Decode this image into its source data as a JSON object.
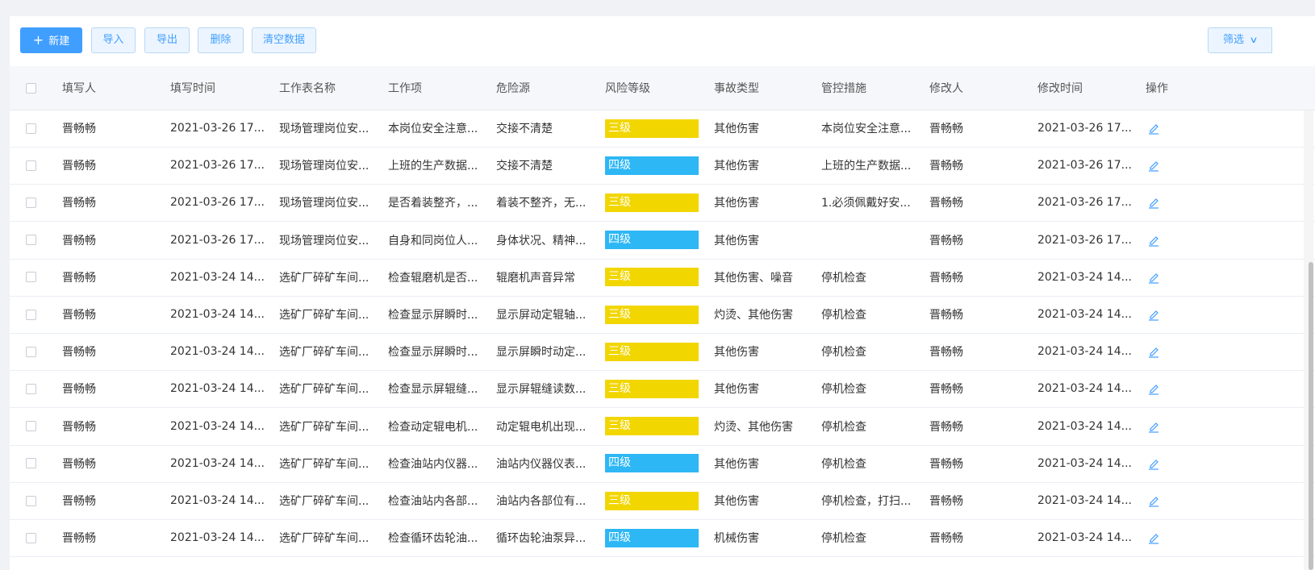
{
  "toolbar": {
    "new_label": "新建",
    "import_label": "导入",
    "export_label": "导出",
    "delete_label": "删除",
    "clear_label": "清空数据",
    "filter_label": "筛选"
  },
  "colors": {
    "三级": "#f2d600",
    "四级": "#2db7f5",
    "primary": "#409eff",
    "edit_icon": "#409eff"
  },
  "table": {
    "columns": [
      "填写人",
      "填写时间",
      "工作表名称",
      "工作项",
      "危险源",
      "风险等级",
      "事故类型",
      "管控措施",
      "修改人",
      "修改时间",
      "操作"
    ],
    "rows": [
      {
        "filler": "晋畅畅",
        "time": "2021-03-26 17...",
        "sheet": "现场管理岗位安...",
        "item": "本岗位安全注意...",
        "hazard": "交接不清楚",
        "risk": "三级",
        "accident": "其他伤害",
        "measure": "本岗位安全注意...",
        "modifier": "晋畅畅",
        "mtime": "2021-03-26 17..."
      },
      {
        "filler": "晋畅畅",
        "time": "2021-03-26 17...",
        "sheet": "现场管理岗位安...",
        "item": "上班的生产数据...",
        "hazard": "交接不清楚",
        "risk": "四级",
        "accident": "其他伤害",
        "measure": "上班的生产数据...",
        "modifier": "晋畅畅",
        "mtime": "2021-03-26 17..."
      },
      {
        "filler": "晋畅畅",
        "time": "2021-03-26 17...",
        "sheet": "现场管理岗位安...",
        "item": "是否着装整齐，...",
        "hazard": "着装不整齐，无...",
        "risk": "三级",
        "accident": "其他伤害",
        "measure": "1.必须佩戴好安...",
        "modifier": "晋畅畅",
        "mtime": "2021-03-26 17..."
      },
      {
        "filler": "晋畅畅",
        "time": "2021-03-26 17...",
        "sheet": "现场管理岗位安...",
        "item": "自身和同岗位人...",
        "hazard": "身体状况、精神...",
        "risk": "四级",
        "accident": "其他伤害",
        "measure": "",
        "modifier": "晋畅畅",
        "mtime": "2021-03-26 17..."
      },
      {
        "filler": "晋畅畅",
        "time": "2021-03-24 14...",
        "sheet": "选矿厂碎矿车间...",
        "item": "检查辊磨机是否...",
        "hazard": "辊磨机声音异常",
        "risk": "三级",
        "accident": "其他伤害、噪音",
        "measure": "停机检查",
        "modifier": "晋畅畅",
        "mtime": "2021-03-24 14..."
      },
      {
        "filler": "晋畅畅",
        "time": "2021-03-24 14...",
        "sheet": "选矿厂碎矿车间...",
        "item": "检查显示屏瞬时...",
        "hazard": "显示屏动定辊轴...",
        "risk": "三级",
        "accident": "灼烫、其他伤害",
        "measure": "停机检查",
        "modifier": "晋畅畅",
        "mtime": "2021-03-24 14..."
      },
      {
        "filler": "晋畅畅",
        "time": "2021-03-24 14...",
        "sheet": "选矿厂碎矿车间...",
        "item": "检查显示屏瞬时...",
        "hazard": "显示屏瞬时动定...",
        "risk": "三级",
        "accident": "其他伤害",
        "measure": "停机检查",
        "modifier": "晋畅畅",
        "mtime": "2021-03-24 14..."
      },
      {
        "filler": "晋畅畅",
        "time": "2021-03-24 14...",
        "sheet": "选矿厂碎矿车间...",
        "item": "检查显示屏辊缝...",
        "hazard": "显示屏辊缝读数...",
        "risk": "三级",
        "accident": "其他伤害",
        "measure": "停机检查",
        "modifier": "晋畅畅",
        "mtime": "2021-03-24 14..."
      },
      {
        "filler": "晋畅畅",
        "time": "2021-03-24 14...",
        "sheet": "选矿厂碎矿车间...",
        "item": "检查动定辊电机...",
        "hazard": "动定辊电机出现...",
        "risk": "三级",
        "accident": "灼烫、其他伤害",
        "measure": "停机检查",
        "modifier": "晋畅畅",
        "mtime": "2021-03-24 14..."
      },
      {
        "filler": "晋畅畅",
        "time": "2021-03-24 14...",
        "sheet": "选矿厂碎矿车间...",
        "item": "检查油站内仪器...",
        "hazard": "油站内仪器仪表...",
        "risk": "四级",
        "accident": "其他伤害",
        "measure": "停机检查",
        "modifier": "晋畅畅",
        "mtime": "2021-03-24 14..."
      },
      {
        "filler": "晋畅畅",
        "time": "2021-03-24 14...",
        "sheet": "选矿厂碎矿车间...",
        "item": "检查油站内各部...",
        "hazard": "油站内各部位有...",
        "risk": "三级",
        "accident": "其他伤害",
        "measure": "停机检查，打扫...",
        "modifier": "晋畅畅",
        "mtime": "2021-03-24 14..."
      },
      {
        "filler": "晋畅畅",
        "time": "2021-03-24 14...",
        "sheet": "选矿厂碎矿车间...",
        "item": "检查循环齿轮油...",
        "hazard": "循环齿轮油泵异...",
        "risk": "四级",
        "accident": "机械伤害",
        "measure": "停机检查",
        "modifier": "晋畅畅",
        "mtime": "2021-03-24 14..."
      }
    ]
  }
}
